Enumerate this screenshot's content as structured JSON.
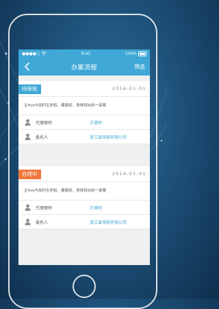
{
  "statusbar": {
    "signal": "●●●●○",
    "time": "9:41",
    "battery": "100%"
  },
  "navbar": {
    "title": "办案流程",
    "filter": "筛选"
  },
  "cards": [
    {
      "status": "待审批",
      "date": "2016-01-01",
      "description": "主five与如何生命权、健康权、身体权纠纷一审案",
      "agent_label": "代理律师",
      "agent_value": "王律师",
      "client_label": "委托人",
      "client_value": "浙江省钱很有限公司"
    },
    {
      "status": "办理中",
      "date": "2016-01-01",
      "description": "主five与如何生命权、健康权、身体权纠纷一审案",
      "agent_label": "代理律师",
      "agent_value": "王律师",
      "client_label": "委托人",
      "client_value": "浙江省钱很有限公司"
    }
  ],
  "colors": {
    "accent": "#3fa8d6",
    "pending": "#3fa8d6",
    "processing": "#f0773a"
  }
}
